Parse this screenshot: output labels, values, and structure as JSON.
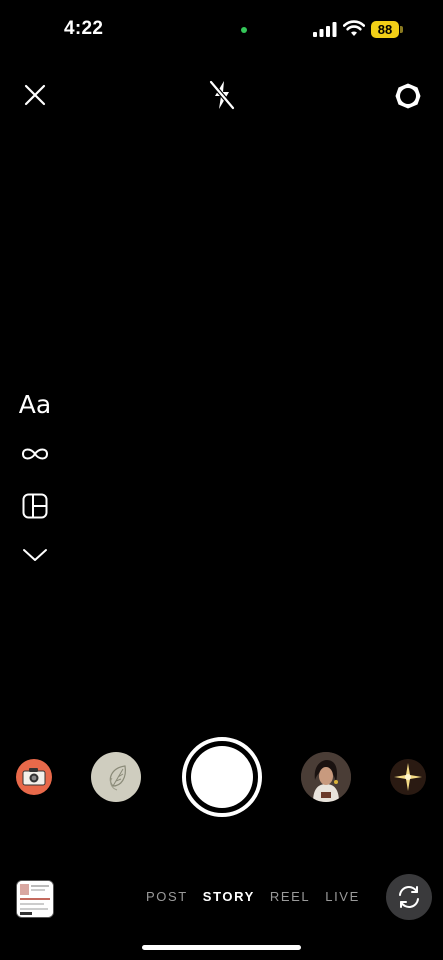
{
  "status_bar": {
    "time": "4:22",
    "battery": "88",
    "icons": [
      "camera-in-use-dot",
      "signal-icon",
      "wifi-icon",
      "battery-icon"
    ]
  },
  "top_controls": {
    "icons": [
      "close-icon",
      "flash-off-icon",
      "settings-icon"
    ]
  },
  "side_tools": {
    "create_label": "Aa",
    "icons": [
      "boomerang-icon",
      "layout-icon",
      "chevron-down-icon"
    ]
  },
  "carousel": {
    "items": [
      "camera-effect-thumbnail",
      "leaf-effect-thumbnail",
      "shutter-button",
      "portrait-effect-thumbnail",
      "sparkle-effect-thumbnail"
    ]
  },
  "bottom_bar": {
    "modes": [
      "POST",
      "STORY",
      "REEL",
      "LIVE"
    ],
    "active_mode": "STORY",
    "icons": [
      "gallery-thumbnail",
      "flip-camera-icon"
    ]
  },
  "colors": {
    "background": "#000000",
    "battery": "#f2cf17",
    "camera_dot": "#34c759",
    "flip_button": "#3a3a3c"
  }
}
